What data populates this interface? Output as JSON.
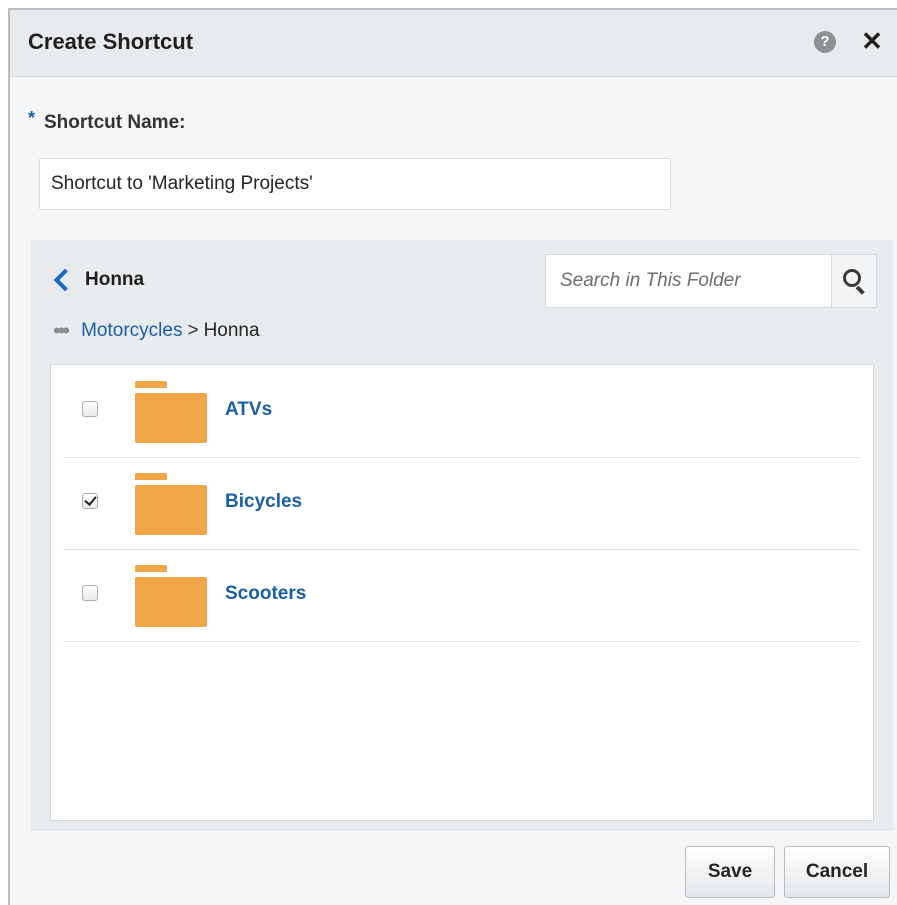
{
  "dialog": {
    "title": "Create Shortcut",
    "help_icon": "question-circle-icon",
    "close_icon": "close-icon",
    "close_glyph": "✕",
    "help_glyph": "?"
  },
  "shortcut_name": {
    "required_marker": "*",
    "label": "Shortcut Name:",
    "value": "Shortcut to 'Marketing Projects'"
  },
  "browser": {
    "current_folder": "Honna",
    "search": {
      "placeholder": "Search in This Folder"
    },
    "breadcrumb": {
      "ellipsis": "•••",
      "parent": "Motorcycles",
      "separator": ">",
      "current": "Honna"
    },
    "items": [
      {
        "label": "ATVs",
        "checked": false,
        "icon": "folder-icon"
      },
      {
        "label": "Bicycles",
        "checked": true,
        "icon": "folder-icon"
      },
      {
        "label": "Scooters",
        "checked": false,
        "icon": "folder-icon"
      }
    ]
  },
  "footer": {
    "save_label": "Save",
    "cancel_label": "Cancel"
  },
  "colors": {
    "link": "#1a5fa8",
    "folder": "#f2a64a",
    "panel": "#e9ecee",
    "header": "#e8ebed"
  }
}
